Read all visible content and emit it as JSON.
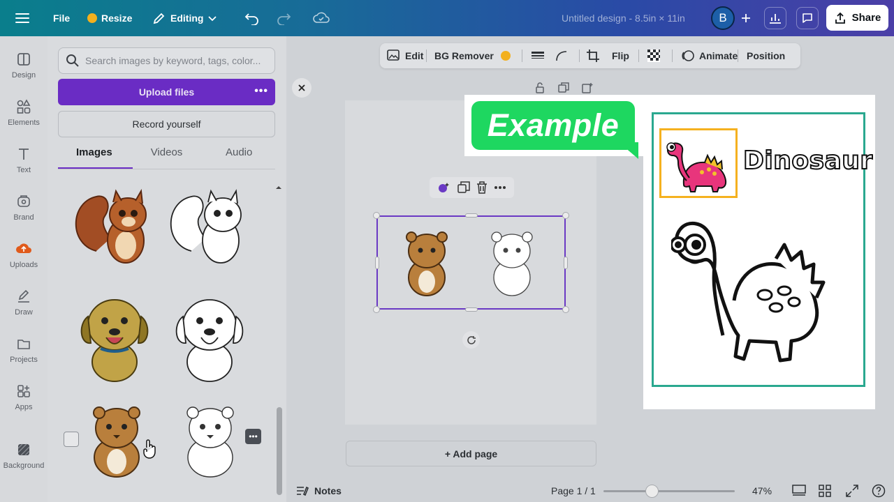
{
  "topbar": {
    "file": "File",
    "resize": "Resize",
    "editing": "Editing",
    "title": "Untitled design - 8.5in × 11in",
    "avatar": "B",
    "share": "Share"
  },
  "rail": {
    "items": [
      {
        "label": "Design",
        "icon": "design-icon"
      },
      {
        "label": "Elements",
        "icon": "elements-icon"
      },
      {
        "label": "Text",
        "icon": "text-icon"
      },
      {
        "label": "Brand",
        "icon": "brand-icon"
      },
      {
        "label": "Uploads",
        "icon": "uploads-icon"
      },
      {
        "label": "Draw",
        "icon": "draw-icon"
      },
      {
        "label": "Projects",
        "icon": "projects-icon"
      },
      {
        "label": "Apps",
        "icon": "apps-icon"
      },
      {
        "label": "Background",
        "icon": "background-icon"
      }
    ]
  },
  "panel": {
    "search_placeholder": "Search images by keyword, tags, color...",
    "upload": "Upload files",
    "upload_more": "•••",
    "record": "Record yourself",
    "tabs": [
      "Images",
      "Videos",
      "Audio"
    ],
    "more_chip": "•••"
  },
  "toolbar": {
    "edit": "Edit",
    "bg_remover": "BG Remover",
    "flip": "Flip",
    "animate": "Animate",
    "position": "Position"
  },
  "editor": {
    "add_page": "+ Add page",
    "notes": "Notes",
    "page_indicator": "Page 1 / 1",
    "zoom": "47%",
    "zoom_fraction": 0.37
  },
  "example": {
    "badge": "Example",
    "word": "Dinosaur"
  },
  "colors": {
    "accent_purple": "#6a2cc4",
    "example_green": "#1ed760",
    "frame_teal": "#2aa88f",
    "frame_orange": "#f5b11f"
  }
}
